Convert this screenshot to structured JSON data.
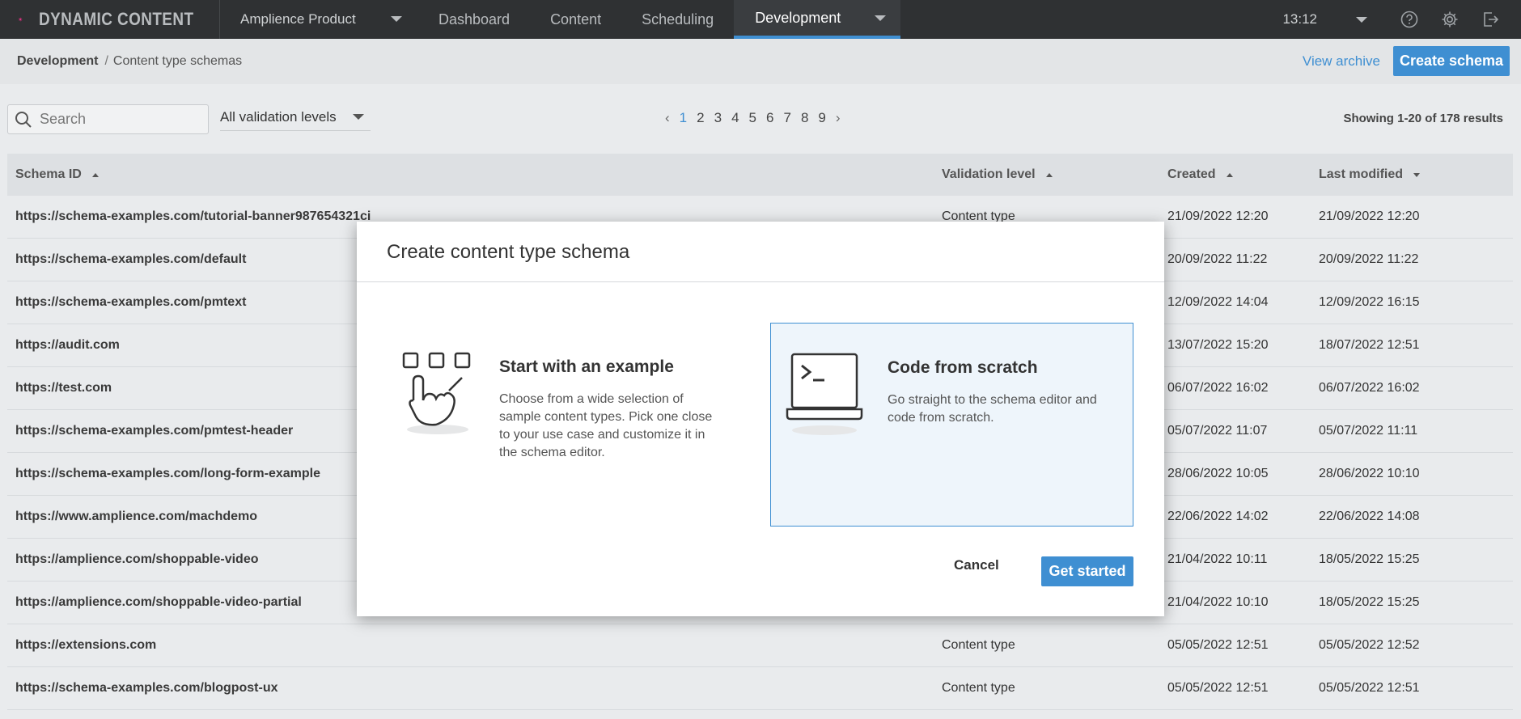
{
  "topnav": {
    "logo_text": "DYNAMIC CONTENT",
    "hub_name": "Amplience Product",
    "tabs": [
      {
        "label": "Dashboard"
      },
      {
        "label": "Content"
      },
      {
        "label": "Scheduling"
      },
      {
        "label": "Development"
      }
    ],
    "active_tab": "Development",
    "time": "13:12",
    "icons": [
      "help-icon",
      "gear-icon",
      "logout-icon"
    ]
  },
  "breadcrumb": {
    "root": "Development",
    "separator": "/",
    "leaf": "Content type schemas"
  },
  "actions": {
    "view_archive": "View archive",
    "create_schema": "Create schema"
  },
  "filters": {
    "search_placeholder": "Search",
    "validation_select": "All validation levels"
  },
  "pagination": {
    "current": "1",
    "pages": [
      "1",
      "2",
      "3",
      "4",
      "5",
      "6",
      "7",
      "8",
      "9"
    ],
    "results_text": "Showing 1-20 of 178 results"
  },
  "table": {
    "headers": {
      "schema_id": "Schema ID",
      "validation": "Validation level",
      "created": "Created",
      "modified": "Last modified"
    },
    "rows": [
      {
        "id": "https://schema-examples.com/tutorial-banner987654321ci",
        "validation": "Content type",
        "created": "21/09/2022 12:20",
        "modified": "21/09/2022 12:20"
      },
      {
        "id": "https://schema-examples.com/default",
        "validation": "",
        "created": "20/09/2022 11:22",
        "modified": "20/09/2022 11:22"
      },
      {
        "id": "https://schema-examples.com/pmtext",
        "validation": "",
        "created": "12/09/2022 14:04",
        "modified": "12/09/2022 16:15"
      },
      {
        "id": "https://audit.com",
        "validation": "",
        "created": "13/07/2022 15:20",
        "modified": "18/07/2022 12:51"
      },
      {
        "id": "https://test.com",
        "validation": "",
        "created": "06/07/2022 16:02",
        "modified": "06/07/2022 16:02"
      },
      {
        "id": "https://schema-examples.com/pmtest-header",
        "validation": "",
        "created": "05/07/2022 11:07",
        "modified": "05/07/2022 11:11"
      },
      {
        "id": "https://schema-examples.com/long-form-example",
        "validation": "",
        "created": "28/06/2022 10:05",
        "modified": "28/06/2022 10:10"
      },
      {
        "id": "https://www.amplience.com/machdemo",
        "validation": "",
        "created": "22/06/2022 14:02",
        "modified": "22/06/2022 14:08"
      },
      {
        "id": "https://amplience.com/shoppable-video",
        "validation": "",
        "created": "21/04/2022 10:11",
        "modified": "18/05/2022 15:25"
      },
      {
        "id": "https://amplience.com/shoppable-video-partial",
        "validation": "",
        "created": "21/04/2022 10:10",
        "modified": "18/05/2022 15:25"
      },
      {
        "id": "https://extensions.com",
        "validation": "Content type",
        "created": "05/05/2022 12:51",
        "modified": "05/05/2022 12:52"
      },
      {
        "id": "https://schema-examples.com/blogpost-ux",
        "validation": "Content type",
        "created": "05/05/2022 12:51",
        "modified": "05/05/2022 12:51"
      }
    ]
  },
  "modal": {
    "title": "Create content type schema",
    "option_example": {
      "title": "Start with an example",
      "description": "Choose from a wide selection of sample content types. Pick one close to your use case and customize it in the schema editor."
    },
    "option_scratch": {
      "title": "Code from scratch",
      "description": "Go straight to the schema editor and code from scratch."
    },
    "cancel_label": "Cancel",
    "start_label": "Get started"
  },
  "colors": {
    "accent": "#3f8fd2",
    "topbar": "#2f3133"
  }
}
